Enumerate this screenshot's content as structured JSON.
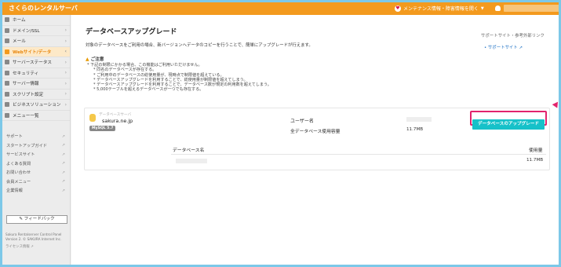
{
  "topbar": {
    "brand": "さくらのレンタルサーバ",
    "maintenance": "メンテナンス情報・障害情報を開く",
    "maintenance_chevron": "▼",
    "user_chevron": "▼",
    "heart_icon": "heart-icon",
    "user_icon": "user-icon"
  },
  "sidebar": {
    "items": [
      {
        "label": "ホーム",
        "icon": "home-icon",
        "arrow": ""
      },
      {
        "label": "ドメイン/SSL",
        "icon": "globe-icon",
        "arrow": "›"
      },
      {
        "label": "メール",
        "icon": "mail-icon",
        "arrow": "›"
      },
      {
        "label": "Webサイト/データ",
        "icon": "web-icon",
        "arrow": "‹",
        "active": true
      },
      {
        "label": "サーバーステータス",
        "icon": "status-icon",
        "arrow": "›"
      },
      {
        "label": "セキュリティ",
        "icon": "lock-icon",
        "arrow": "›"
      },
      {
        "label": "サーバー情報",
        "icon": "info-icon",
        "arrow": "›"
      },
      {
        "label": "スクリプト設定",
        "icon": "script-icon",
        "arrow": "›"
      },
      {
        "label": "ビジネスソリューション",
        "icon": "business-icon",
        "arrow": "›"
      },
      {
        "label": "メニュー一覧",
        "icon": "menu-icon",
        "arrow": ""
      }
    ],
    "links": [
      "サポート",
      "スタートアップガイド",
      "サービスサイト",
      "よくある質問",
      "お問い合わせ",
      "会員メニュー",
      "企業情報"
    ],
    "external_mark": "↗",
    "feedback": "フィードバック",
    "footer_lines": [
      "Sakura Rentalserver Control Panel",
      "Version 2. © SAKURA Internet Inc."
    ],
    "footer_link": "ライセンス情報"
  },
  "main": {
    "title": "データベースアップグレード",
    "description": "対象のデータベースをご利用の場合、新バージョンへデータのコピーを行うことで、簡単にアップグレードが行えます。",
    "related_title": "サポートサイト・参考外部リンク",
    "related_link": "サポートサイト",
    "note_title": "ご注意",
    "notes": [
      {
        "text": "下記の制限にかかる場合、この機能はご利用いただけません。",
        "sub": false
      },
      {
        "text": "同名のデータベースが存在する。",
        "sub": true
      },
      {
        "text": "ご利用中のデータベースの総使用量が、現時点で制限値を超えている。",
        "sub": true
      },
      {
        "text": "データベースアップグレードを利用することで、総使用量が制限値を超えてしまう。",
        "sub": true
      },
      {
        "text": "データベースアップグレードを利用することで、データベース数が規定の利用数を超えてしまう。",
        "sub": true
      },
      {
        "text": "5,000テーブルを超えるデータベースが一つでも存在する。",
        "sub": true
      }
    ],
    "card": {
      "server_label": "データベースサーバ",
      "server_name": "sakura.ne.jp",
      "mysql": "MySQL 5.7",
      "user_label": "ユーザー名",
      "usage_label": "全データベース使用容量",
      "usage_value": "11.7MB",
      "upgrade_button": "データベースのアップグレード",
      "col_dbname": "データベース名",
      "col_usage": "使用量",
      "row_usage": "11.7MB"
    }
  },
  "colors": {
    "topbar": "#f39a1e",
    "accent": "#16c1c9",
    "highlight": "#e2246d"
  }
}
